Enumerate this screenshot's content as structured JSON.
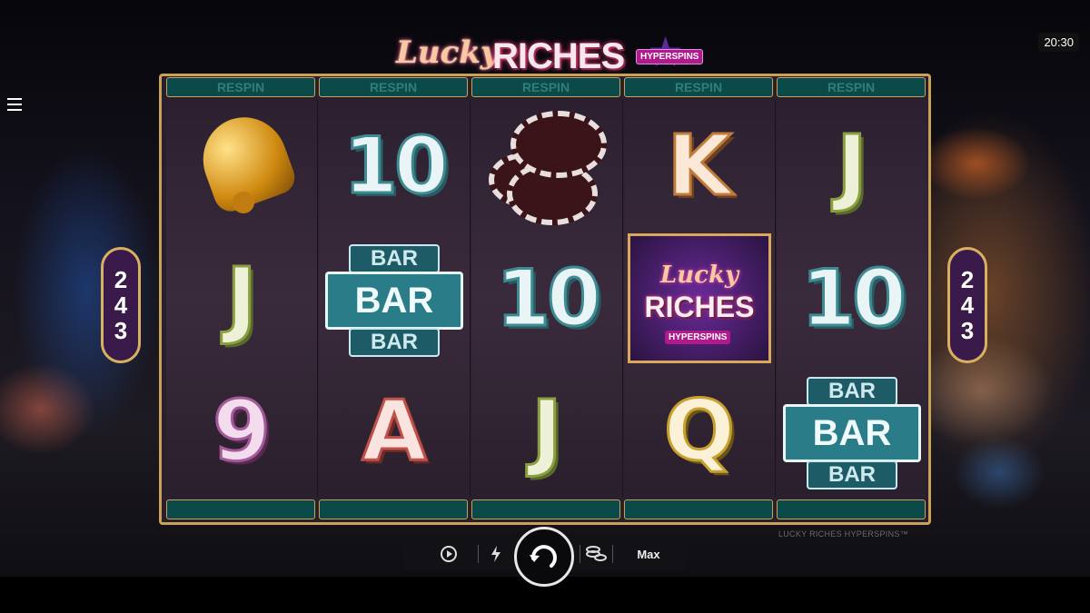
{
  "status": {
    "clock": "20:30"
  },
  "logo": {
    "word1": "Lucky",
    "word2": "RICHES",
    "badge": "HYPERSPINS"
  },
  "respin_labels": [
    "RESPIN",
    "RESPIN",
    "RESPIN",
    "RESPIN",
    "RESPIN"
  ],
  "ways": {
    "digits": [
      "2",
      "4",
      "3"
    ]
  },
  "reels": [
    [
      "bell",
      "J",
      "9"
    ],
    [
      "10",
      "BAR",
      "A"
    ],
    [
      "chips",
      "10",
      "J"
    ],
    [
      "K",
      "logo",
      "Q"
    ],
    [
      "J",
      "10",
      "BAR"
    ]
  ],
  "symbols": {
    "J": "J",
    "10": "10",
    "9": "9",
    "A": "A",
    "K": "K",
    "Q": "Q",
    "bar_small": "BAR",
    "bar_big": "BAR",
    "logo_word1": "Lucky",
    "logo_word2": "RICHES",
    "logo_badge": "HYPERSPINS"
  },
  "footer": {
    "game_name": "LUCKY RICHES HYPERSPINS™"
  },
  "controls": {
    "max_label": "Max"
  },
  "icons": {
    "menu": "hamburger-icon",
    "autoplay": "autoplay-icon",
    "turbo": "lightning-icon",
    "spin": "spin-arrow-icon",
    "bet": "coin-stack-icon"
  },
  "colors": {
    "frame_gold": "#c9a25a",
    "respin_teal": "#0c4a4a",
    "ways_purple": "#3a1a4a"
  }
}
